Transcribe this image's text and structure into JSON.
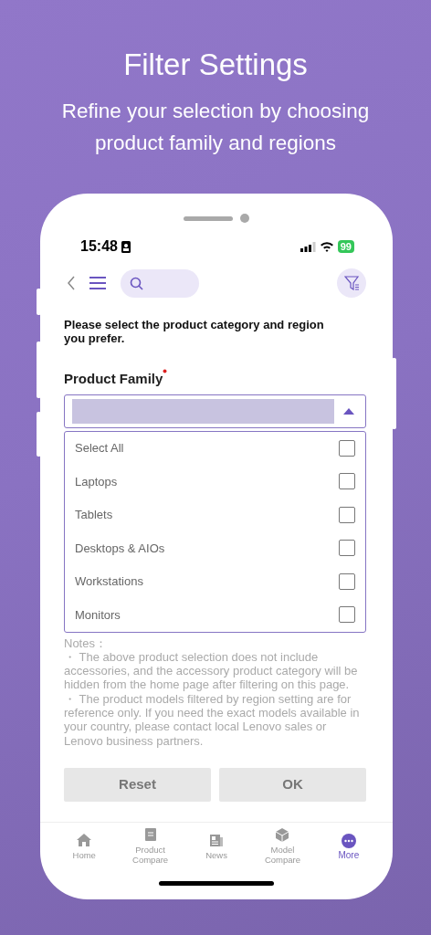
{
  "header": {
    "title": "Filter Settings",
    "subtitle": "Refine your selection by choosing product family and regions"
  },
  "status_bar": {
    "time": "15:48",
    "battery": "99"
  },
  "prompt": "Please select the product category and region you prefer.",
  "field": {
    "label": "Product Family",
    "required": true,
    "expanded": true
  },
  "options": [
    {
      "label": "Select All",
      "checked": false
    },
    {
      "label": "Laptops",
      "checked": false
    },
    {
      "label": "Tablets",
      "checked": false
    },
    {
      "label": "Desktops & AIOs",
      "checked": false
    },
    {
      "label": "Workstations",
      "checked": false
    },
    {
      "label": "Monitors",
      "checked": false
    }
  ],
  "notes": {
    "title": "Notes：",
    "items": [
      "・ The above product selection does not include accessories, and the accessory product category will be hidden from the home page after filtering on this page.",
      "・ The product models filtered by region setting are for reference only. If you need the exact models available in your country, please contact local Lenovo sales or Lenovo business partners."
    ]
  },
  "buttons": [
    {
      "label": "Reset",
      "disabled": true
    },
    {
      "label": "OK",
      "disabled": true
    }
  ],
  "tabs": [
    {
      "kind": "home",
      "label": "Home",
      "selected": false
    },
    {
      "kind": "document",
      "label": "Product Compare",
      "selected": false
    },
    {
      "kind": "news",
      "label": "News",
      "selected": false
    },
    {
      "kind": "cube",
      "label": "Model Compare",
      "selected": false
    },
    {
      "kind": "more",
      "label": "More",
      "selected": true
    }
  ]
}
